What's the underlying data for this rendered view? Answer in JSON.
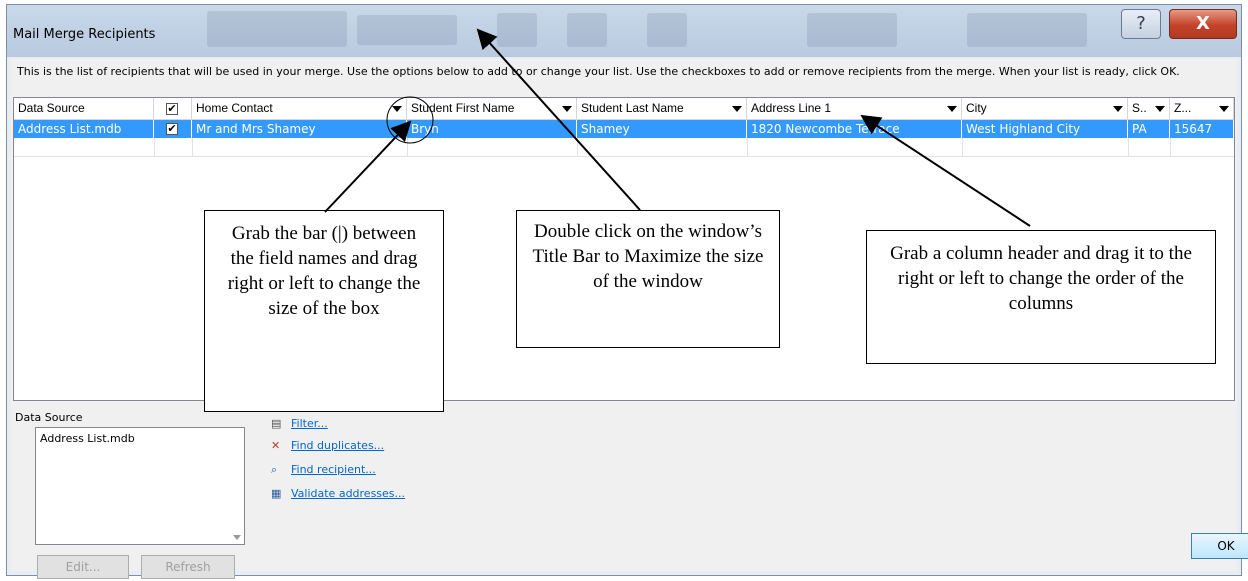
{
  "window": {
    "title": "Mail Merge Recipients",
    "help_icon": "question-mark",
    "close_icon": "close-x",
    "help_glyph": "?",
    "close_glyph": "X"
  },
  "intro_text": "This is the list of recipients that will be used in your merge.  Use the options below to add to or change your list.  Use the checkboxes to add or remove recipients from the merge.  When your list is ready, click OK.",
  "table": {
    "columns": [
      "Data Source",
      "",
      "Home Contact",
      "Student First Name",
      "Student Last Name",
      "Address Line 1",
      "City",
      "S..",
      "Z..."
    ],
    "rows": [
      {
        "data_source": "Address List.mdb",
        "checked": "✔",
        "home_contact": "Mr and Mrs Shamey",
        "first_name": "Bryn",
        "last_name": "Shamey",
        "address": "1820 Newcombe Terrace",
        "city": "West Highland City",
        "state": "PA",
        "zip": "15647"
      }
    ],
    "header_check": "✔",
    "selected_color": "#3399ff"
  },
  "data_source": {
    "label": "Data Source",
    "items": [
      "Address List.mdb"
    ],
    "edit_label": "Edit...",
    "refresh_label": "Refresh"
  },
  "refine": {
    "filter_label": "Filter...",
    "find_duplicates_label": "Find duplicates...",
    "find_recipient_label": "Find recipient...",
    "validate_label": "Validate addresses..."
  },
  "ok_label": "OK",
  "callouts": {
    "resize": "Grab the bar (|) between the field names and drag right or left to change the size of the box",
    "maximize": "Double click on the window’s Title Bar to Maximize the size of the window",
    "reorder": "Grab a column header and drag it to the right or left to change the order of the columns"
  }
}
